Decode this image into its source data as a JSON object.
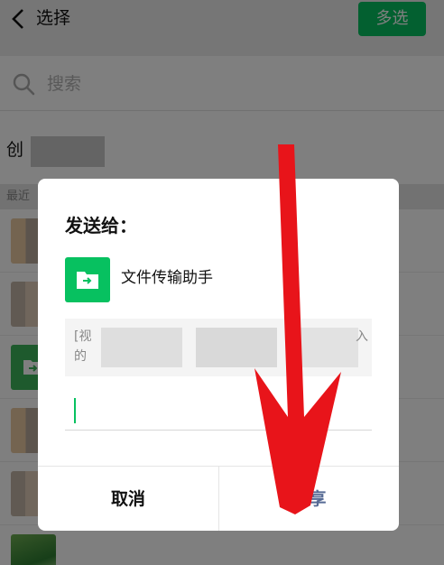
{
  "header": {
    "title": "选择",
    "multi_select_label": "多选",
    "back_icon": "back-arrow-icon"
  },
  "search": {
    "placeholder": "搜索",
    "icon": "search-icon"
  },
  "create": {
    "label": "创"
  },
  "recent": {
    "label": "最近"
  },
  "dialog": {
    "title": "发送给：",
    "target": {
      "name": "文件传输助手",
      "icon": "file-transfer-icon"
    },
    "preview_line1": "[视",
    "preview_line2": "的",
    "preview_tail": "入",
    "cancel_label": "取消",
    "share_label": "分享"
  },
  "colors": {
    "accent": "#07c160",
    "share_text": "#576b95",
    "annotation_arrow": "#e8141a"
  }
}
